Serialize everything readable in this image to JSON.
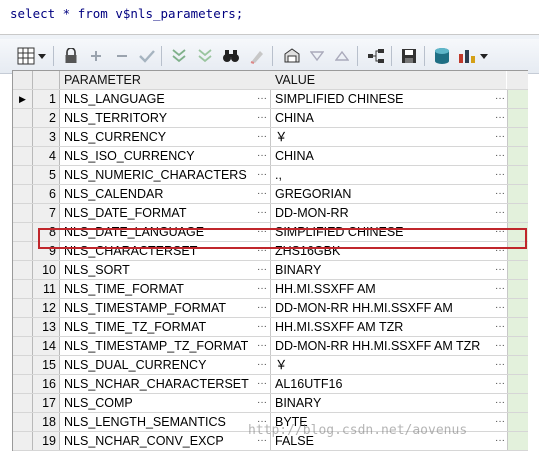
{
  "editor": {
    "sql_text": "select * from v$nls_parameters;"
  },
  "toolbar": {
    "icons": [
      "grid-icon",
      "dropdown-arrow-icon",
      "lock-icon",
      "add-icon",
      "remove-icon",
      "check-icon",
      "move-down-icon",
      "move-up-icon",
      "binoculars-icon",
      "clear-icon",
      "print-icon",
      "triangle-down-icon",
      "triangle-up-icon",
      "tree-icon",
      "save-icon",
      "database-icon",
      "chart-icon",
      "dropdown-arrow-icon"
    ]
  },
  "grid": {
    "columns": [
      "PARAMETER",
      "VALUE"
    ],
    "rows": [
      {
        "num": "1",
        "param": "NLS_LANGUAGE",
        "value": "SIMPLIFIED CHINESE"
      },
      {
        "num": "2",
        "param": "NLS_TERRITORY",
        "value": "CHINA"
      },
      {
        "num": "3",
        "param": "NLS_CURRENCY",
        "value": "￥"
      },
      {
        "num": "4",
        "param": "NLS_ISO_CURRENCY",
        "value": "CHINA"
      },
      {
        "num": "5",
        "param": "NLS_NUMERIC_CHARACTERS",
        "value": ".,"
      },
      {
        "num": "6",
        "param": "NLS_CALENDAR",
        "value": "GREGORIAN"
      },
      {
        "num": "7",
        "param": "NLS_DATE_FORMAT",
        "value": "DD-MON-RR"
      },
      {
        "num": "8",
        "param": "NLS_DATE_LANGUAGE",
        "value": "SIMPLIFIED CHINESE"
      },
      {
        "num": "9",
        "param": "NLS_CHARACTERSET",
        "value": "ZHS16GBK"
      },
      {
        "num": "10",
        "param": "NLS_SORT",
        "value": "BINARY"
      },
      {
        "num": "11",
        "param": "NLS_TIME_FORMAT",
        "value": "HH.MI.SSXFF AM"
      },
      {
        "num": "12",
        "param": "NLS_TIMESTAMP_FORMAT",
        "value": "DD-MON-RR HH.MI.SSXFF AM"
      },
      {
        "num": "13",
        "param": "NLS_TIME_TZ_FORMAT",
        "value": "HH.MI.SSXFF AM TZR"
      },
      {
        "num": "14",
        "param": "NLS_TIMESTAMP_TZ_FORMAT",
        "value": "DD-MON-RR HH.MI.SSXFF AM TZR"
      },
      {
        "num": "15",
        "param": "NLS_DUAL_CURRENCY",
        "value": "￥"
      },
      {
        "num": "16",
        "param": "NLS_NCHAR_CHARACTERSET",
        "value": "AL16UTF16"
      },
      {
        "num": "17",
        "param": "NLS_COMP",
        "value": "BINARY"
      },
      {
        "num": "18",
        "param": "NLS_LENGTH_SEMANTICS",
        "value": "BYTE"
      },
      {
        "num": "19",
        "param": "NLS_NCHAR_CONV_EXCP",
        "value": "FALSE"
      }
    ],
    "ellipsis": "···",
    "current_row_marker": "▶"
  },
  "watermark": "http://blog.csdn.net/aovenus",
  "colors": {
    "highlight_border": "#c0262b",
    "row_accent": "#e3f1dc"
  }
}
